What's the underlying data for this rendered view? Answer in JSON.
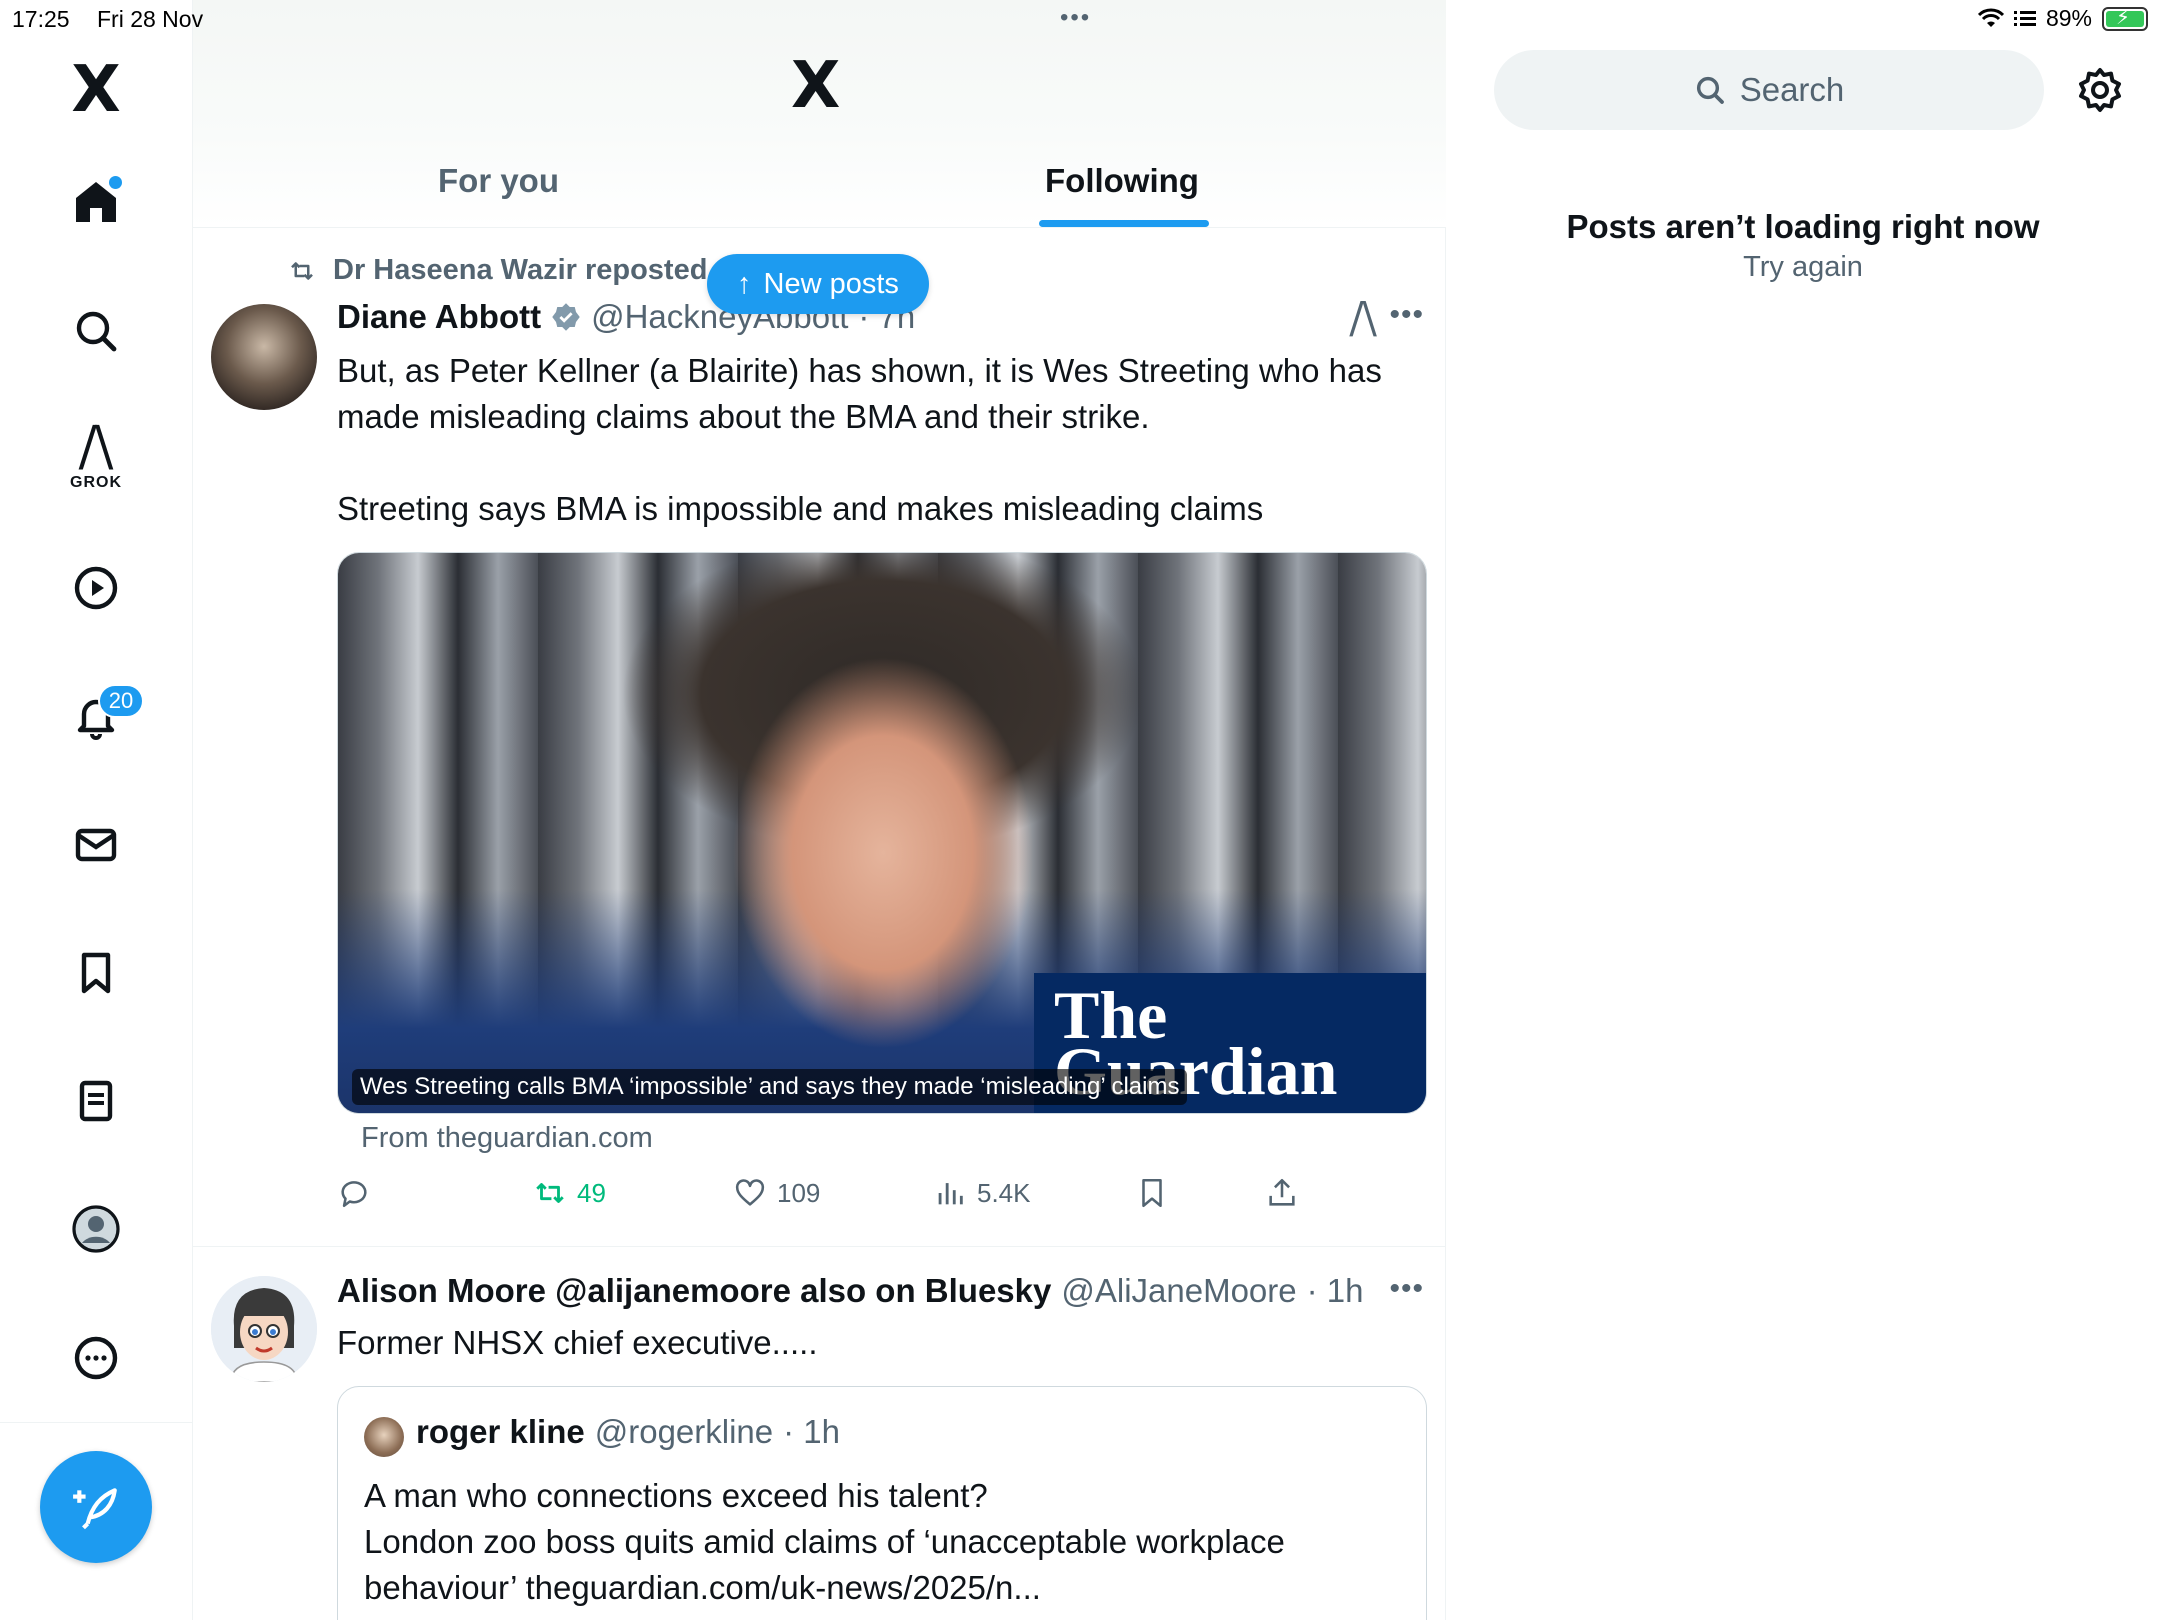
{
  "status_bar": {
    "time": "17:25",
    "date": "Fri 28 Nov",
    "battery": "89%"
  },
  "sidebar": {
    "logo": "X",
    "grok_label": "GROK",
    "notifications_badge": "20",
    "items": [
      "home-icon",
      "search-icon",
      "grok-icon",
      "video-icon",
      "notifications-icon",
      "messages-icon",
      "bookmarks-icon",
      "lists-icon",
      "profile-icon",
      "more-icon"
    ]
  },
  "header": {
    "logo": "X",
    "tabs": [
      {
        "label": "For you",
        "selected": false
      },
      {
        "label": "Following",
        "selected": true
      }
    ]
  },
  "new_posts_label": "New posts",
  "posts": [
    {
      "repost_label": "Dr Haseena Wazir reposted",
      "display_name": "Diane Abbott",
      "verified": true,
      "handle": "@HackneyAbbott",
      "time": "· 7h",
      "text": "But, as Peter Kellner (a Blairite) has shown, it is Wes Streeting who has made misleading claims about the BMA and their strike.\n\nStreeting says BMA is impossible and makes misleading claims",
      "card": {
        "brand": "The Guardian",
        "caption": "Wes Streeting calls BMA ‘impossible’ and says they made ‘misleading’ claims",
        "source": "From theguardian.com"
      },
      "actions": {
        "reposts": "49",
        "likes": "109",
        "views": "5.4K"
      }
    },
    {
      "display_name": "Alison Moore @alijanemoore also on Bluesky",
      "handle": "@AliJaneMoore",
      "time": "· 1h",
      "text": "Former NHSX chief executive.....",
      "quote": {
        "display_name": "roger kline",
        "handle": "@rogerkline",
        "time": "· 1h",
        "text": "A man who connections exceed his talent?\nLondon zoo boss quits amid claims of ‘unacceptable workplace behaviour’ theguardian.com/uk-news/2025/n..."
      }
    }
  ],
  "right_panel": {
    "search_placeholder": "Search",
    "error_title": "Posts aren’t loading right now",
    "error_action": "Try again"
  },
  "colors": {
    "accent": "#1d9bf0",
    "repost_green": "#00ba7c",
    "secondary_text": "#536471",
    "guardian_blue": "#052962"
  }
}
